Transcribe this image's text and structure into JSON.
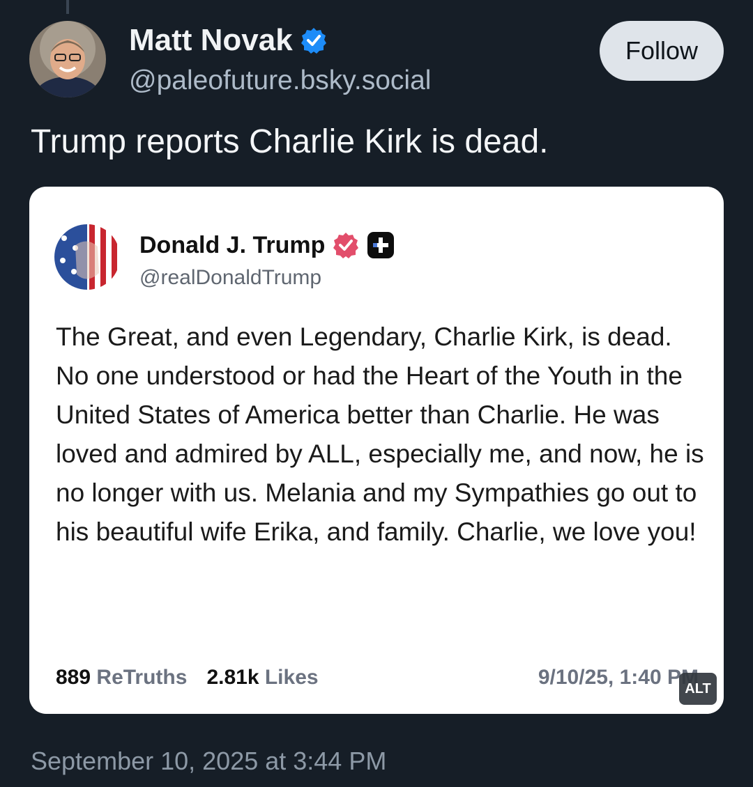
{
  "author": {
    "name": "Matt Novak",
    "handle": "@paleofuture.bsky.social"
  },
  "follow_label": "Follow",
  "post_text": "Trump reports Charlie Kirk is dead.",
  "embed": {
    "name": "Donald J. Trump",
    "handle": "@realDonaldTrump",
    "body": "The Great, and even Legendary, Charlie Kirk, is dead. No one understood or had the Heart of the Youth in the United States of America better than Charlie. He was loved and admired by ALL, especially me, and now, he is no longer with us. Melania and my Sympathies go out to his beautiful wife Erika, and family. Charlie, we love you!",
    "retruths_count": "889",
    "retruths_label": "ReTruths",
    "likes_count": "2.81k",
    "likes_label": "Likes",
    "timestamp": "9/10/25, 1:40 PM"
  },
  "alt_badge": "ALT",
  "post_timestamp": "September 10, 2025 at 3:44 PM",
  "colors": {
    "background": "#161e27",
    "verified_blue": "#1d8cf8",
    "truth_badge_red": "#e24e6b",
    "follow_bg": "#dfe4ea"
  },
  "icons": [
    "verified-badge-icon",
    "truth-verified-icon",
    "plus-badge-icon"
  ]
}
